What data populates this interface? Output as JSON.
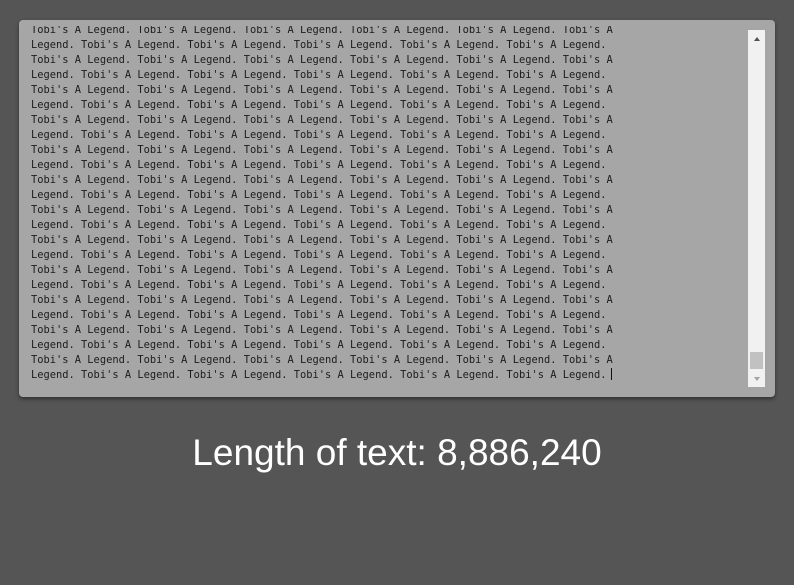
{
  "textarea": {
    "line_a": "Tobi's A Legend. Tobi's A Legend. Tobi's A Legend. Tobi's A Legend. Tobi's A Legend. Tobi's A",
    "line_b": "Legend. Tobi's A Legend. Tobi's A Legend. Tobi's A Legend. Tobi's A Legend. Tobi's A Legend.",
    "visible_line_count": 24
  },
  "length_label": {
    "prefix": "Length of text: ",
    "value": "8,886,240"
  },
  "colors": {
    "page_background": "#555555",
    "textarea_background": "#a6a6a6",
    "label_text": "#ffffff"
  },
  "icons": {
    "scroll_up": "triangle-up",
    "scroll_down": "triangle-down"
  }
}
